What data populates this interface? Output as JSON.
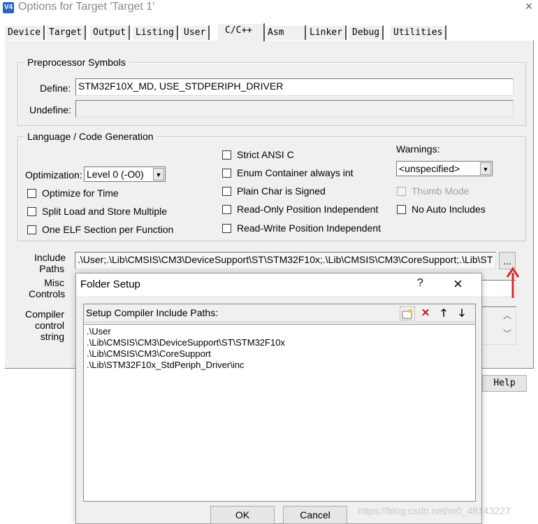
{
  "main_dialog": {
    "title": "Options for Target 'Target 1'",
    "app_icon": "V4",
    "close_glyph": "×",
    "tabs": [
      "Device",
      "Target",
      "Output",
      "Listing",
      "User",
      "C/C++",
      "Asm",
      "Linker",
      "Debug",
      "Utilities"
    ],
    "active_tab": "C/C++",
    "preprocessor": {
      "group_title": "Preprocessor Symbols",
      "define_label": "Define:",
      "define_value": "STM32F10X_MD, USE_STDPERIPH_DRIVER",
      "undefine_label": "Undefine:",
      "undefine_value": ""
    },
    "language": {
      "group_title": "Language / Code Generation",
      "optimization_label": "Optimization:",
      "optimization_value": "Level 0 (-O0)",
      "checks_left": [
        "Optimize for Time",
        "Split Load and Store Multiple",
        "One ELF Section per Function"
      ],
      "checks_middle": [
        "Strict ANSI C",
        "Enum Container always int",
        "Plain Char is Signed",
        "Read-Only Position Independent",
        "Read-Write Position Independent"
      ],
      "warnings_label": "Warnings:",
      "warnings_value": "<unspecified>",
      "thumb_mode": "Thumb Mode",
      "no_auto_includes": "No Auto Includes"
    },
    "include_paths": {
      "label_line1": "Include",
      "label_line2": "Paths",
      "value": ".\\User;.\\Lib\\CMSIS\\CM3\\DeviceSupport\\ST\\STM32F10x;.\\Lib\\CMSIS\\CM3\\CoreSupport;.\\Lib\\ST",
      "browse_label": "..."
    },
    "misc_controls": {
      "label_line1": "Misc",
      "label_line2": "Controls"
    },
    "compiler_control": {
      "label_line1": "Compiler",
      "label_line2": "control",
      "label_line3": "string"
    },
    "help_button": "Help",
    "accent_color": "#e0252a"
  },
  "folder_setup": {
    "title": "Folder Setup",
    "help_glyph": "?",
    "close_glyph": "×",
    "panel_label": "Setup Compiler Include Paths:",
    "toolbar_icons": [
      "new-folder-icon",
      "delete-icon",
      "move-up-icon",
      "move-down-icon"
    ],
    "paths": [
      ".\\User",
      ".\\Lib\\CMSIS\\CM3\\DeviceSupport\\ST\\STM32F10x",
      ".\\Lib\\CMSIS\\CM3\\CoreSupport",
      ".\\Lib\\STM32F10x_StdPeriph_Driver\\inc"
    ],
    "ok_label": "OK",
    "cancel_label": "Cancel"
  },
  "watermark": "https://blog.csdn.net/m0_48143227"
}
